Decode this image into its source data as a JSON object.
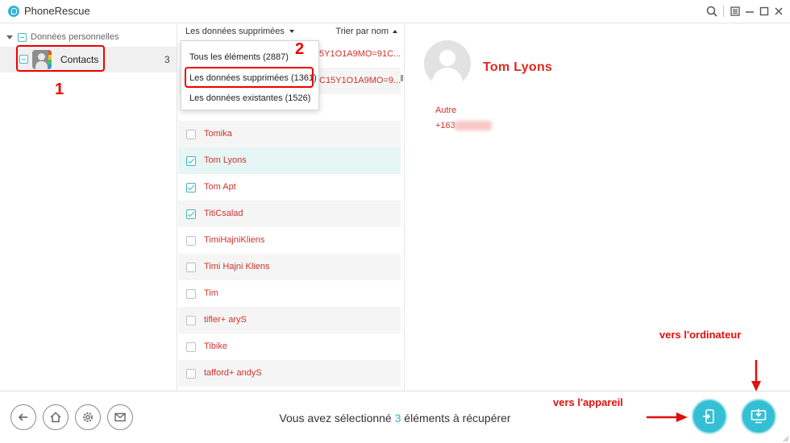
{
  "app": {
    "title": "PhoneRescue"
  },
  "sidebar": {
    "root_label": "Données personnelles",
    "category": {
      "label": "Contacts",
      "count": "3"
    },
    "annotation_number": "1"
  },
  "list": {
    "filter_label": "Les données supprimées",
    "sort_label": "Trier par nom",
    "hidden_rows": [
      {
        "text": "5Y1O1A9MO=91C..."
      },
      {
        "text": "C15Y1O1A9MO=9..."
      }
    ],
    "rows": [
      {
        "name": "Tomika",
        "checked": false
      },
      {
        "name": "Tom  Lyons",
        "checked": true
      },
      {
        "name": "Tom   Apt",
        "checked": true
      },
      {
        "name": "TitiCsalad",
        "checked": true
      },
      {
        "name": "TimiHajniKliens",
        "checked": false
      },
      {
        "name": "Timi Hajni Kliens",
        "checked": false
      },
      {
        "name": "Tim",
        "checked": false
      },
      {
        "name": "tifler+ aryS",
        "checked": false
      },
      {
        "name": "Tibike",
        "checked": false
      },
      {
        "name": "tafford+ andyS",
        "checked": false
      }
    ]
  },
  "dropdown": {
    "options": [
      {
        "label": "Tous les éléments (2887)"
      },
      {
        "label": "Les données supprimées (1361)"
      },
      {
        "label": "Les données existantes (1526)"
      }
    ],
    "selected_index": 1,
    "annotation_number": "2"
  },
  "detail": {
    "name": "Tom  Lyons",
    "field_label": "Autre",
    "field_value": "+163"
  },
  "bottom": {
    "status_prefix": "Vous avez sélectionné ",
    "status_count": "3",
    "status_suffix": " éléments à récupérer",
    "annotation_device": "vers l'appareil",
    "annotation_computer": "vers l'ordinateur"
  },
  "colors": {
    "accent": "#34bfd4",
    "deleted_text": "#d0332c",
    "annotation": "#e0100a"
  }
}
